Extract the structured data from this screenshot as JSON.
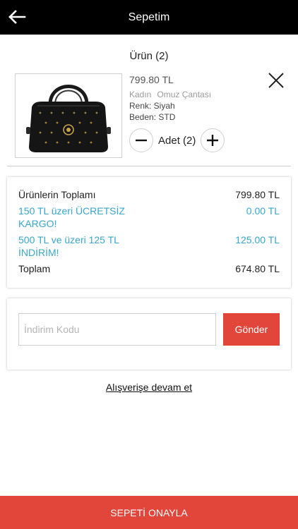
{
  "header": {
    "title": "Sepetim",
    "back_icon": "arrow-left-icon"
  },
  "cart": {
    "section_title": "Ürün (2)",
    "item": {
      "image_icon": "handbag-image",
      "price": "799.80 TL",
      "category_1": "Kadın",
      "category_2": "Omuz Çantası",
      "color_line": "Renk: Siyah",
      "size_line": "Beden: STD",
      "quantity_label": "Adet (2)",
      "remove_icon": "close-icon",
      "decrease_icon": "minus-icon",
      "increase_icon": "plus-icon"
    }
  },
  "summary": {
    "subtotal_label": "Ürünlerin Toplamı",
    "subtotal_value": "799.80 TL",
    "shipping_label": "150 TL üzeri ÜCRETSİZ KARGO!",
    "shipping_value": "0.00 TL",
    "discount_label": "500 TL ve üzeri 125 TL İNDİRİM!",
    "discount_value": "125.00 TL",
    "total_label": "Toplam",
    "total_value": "674.80 TL"
  },
  "coupon": {
    "placeholder": "İndirim Kodu",
    "value": "",
    "submit_label": "Gönder"
  },
  "continue_label": "Alışverişe devam et",
  "confirm_label": "SEPETİ ONAYLA",
  "colors": {
    "header_bg": "#000000",
    "accent_red": "#e2463a",
    "promo_blue": "#3aa6c8"
  }
}
